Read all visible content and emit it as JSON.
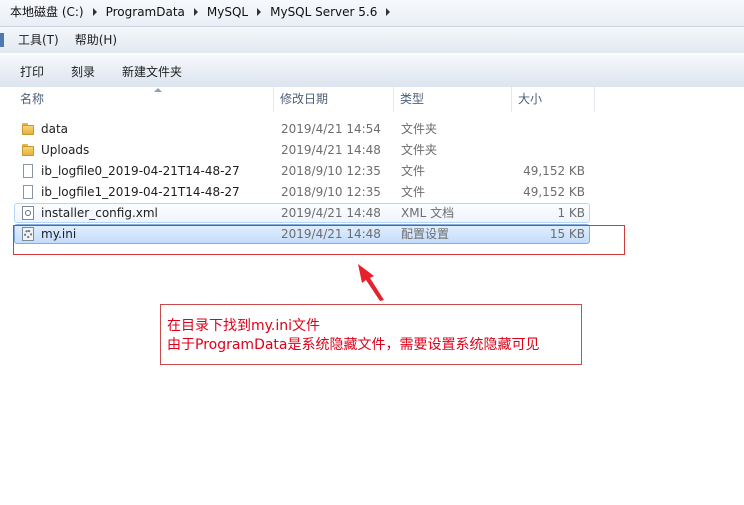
{
  "address_bar": {
    "crumbs": [
      "本地磁盘 (C:)",
      "ProgramData",
      "MySQL",
      "MySQL Server 5.6"
    ]
  },
  "menu": {
    "items": [
      "工具(T)",
      "帮助(H)"
    ]
  },
  "toolbar": {
    "buttons": [
      "打印",
      "刻录",
      "新建文件夹"
    ]
  },
  "columns": {
    "name": "名称",
    "date": "修改日期",
    "type": "类型",
    "size": "大小"
  },
  "files": [
    {
      "name": "data",
      "date": "2019/4/21 14:54",
      "type": "文件夹",
      "size": "",
      "icon": "folder-icon"
    },
    {
      "name": "Uploads",
      "date": "2019/4/21 14:48",
      "type": "文件夹",
      "size": "",
      "icon": "folder-icon"
    },
    {
      "name": "ib_logfile0_2019-04-21T14-48-27",
      "date": "2018/9/10 12:35",
      "type": "文件",
      "size": "49,152 KB",
      "icon": "file-icon"
    },
    {
      "name": "ib_logfile1_2019-04-21T14-48-27",
      "date": "2018/9/10 12:35",
      "type": "文件",
      "size": "49,152 KB",
      "icon": "file-icon"
    },
    {
      "name": "installer_config.xml",
      "date": "2019/4/21 14:48",
      "type": "XML 文档",
      "size": "1 KB",
      "icon": "xml-file-icon"
    },
    {
      "name": "my.ini",
      "date": "2019/4/21 14:48",
      "type": "配置设置",
      "size": "15 KB",
      "icon": "ini-file-icon"
    }
  ],
  "annotation": {
    "line1": "在目录下找到my.ini文件",
    "line2": "由于ProgramData是系统隐藏文件，需要设置系统隐藏可见",
    "color": "#e0001a"
  }
}
